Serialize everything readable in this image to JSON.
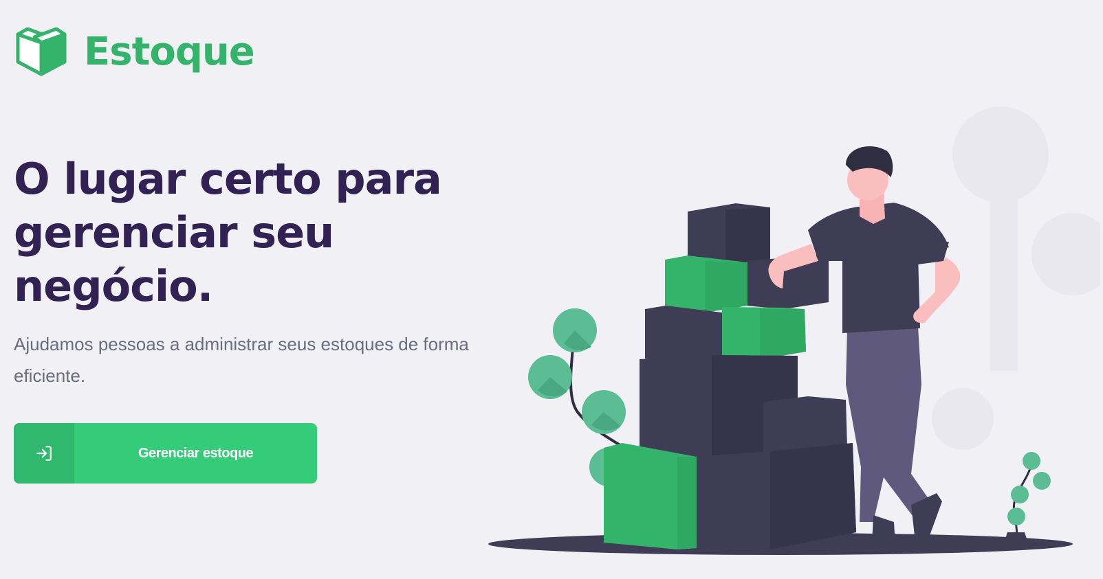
{
  "brand": {
    "name": "Estoque",
    "color": "#34b36b",
    "icon": "open-box-icon"
  },
  "hero": {
    "title": "O lugar certo para gerenciar seu negócio.",
    "description": "Ajudamos pessoas a administrar seus estoques de forma eficiente.",
    "title_color": "#322153",
    "text_color": "#6c6c80"
  },
  "cta": {
    "label": "Gerenciar estoque",
    "icon": "sign-in-icon",
    "color": "#34cb79"
  },
  "illustration": {
    "subject": "person-leaning-on-stacked-boxes",
    "accent_color": "#34b36b",
    "dark_color": "#3f3d56"
  }
}
